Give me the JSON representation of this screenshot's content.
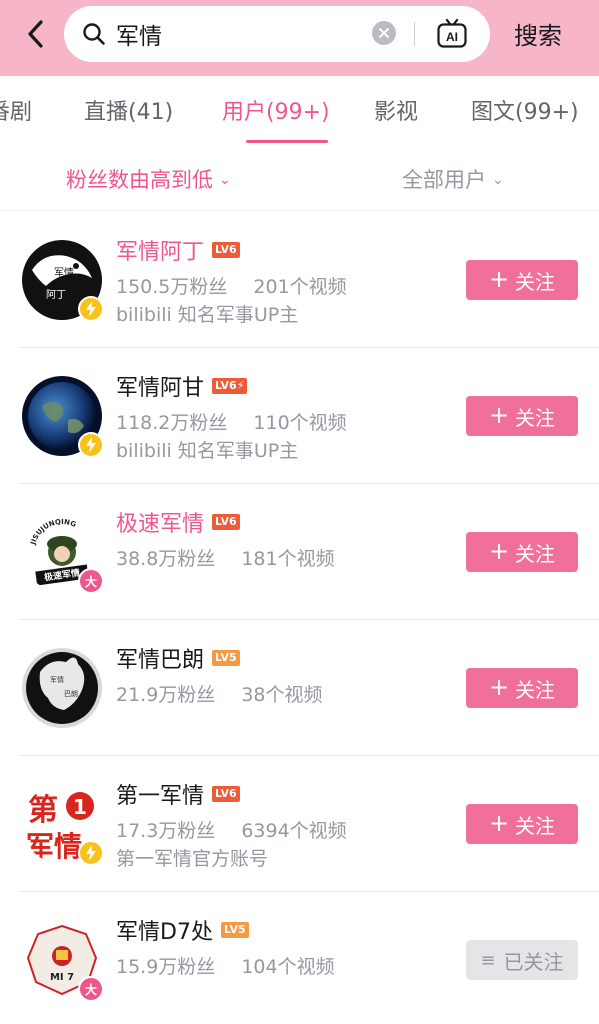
{
  "search": {
    "query": "军情",
    "submit_label": "搜索",
    "ai_label": "AI"
  },
  "tabs": [
    {
      "label": "番剧"
    },
    {
      "label": "直播(41)"
    },
    {
      "label": "用户(99+)"
    },
    {
      "label": "影视"
    },
    {
      "label": "图文(99+)"
    }
  ],
  "filters": {
    "sort": "粉丝数由高到低",
    "user_type": "全部用户"
  },
  "users": [
    {
      "name": "军情阿丁",
      "level": "LV6",
      "fans": "150.5万粉丝",
      "videos": "201个视频",
      "desc": "bilibili 知名军事UP主",
      "follow": "关注",
      "avatar_text_top": "军情",
      "avatar_text_bottom": "阿丁"
    },
    {
      "name": "军情阿甘",
      "level": "LV6",
      "fans": "118.2万粉丝",
      "videos": "110个视频",
      "desc": "bilibili 知名军事UP主",
      "follow": "关注"
    },
    {
      "name": "极速军情",
      "level": "LV6",
      "fans": "38.8万粉丝",
      "videos": "181个视频",
      "desc": "",
      "follow": "关注",
      "avatar_text_top": "JISUJUNQING",
      "avatar_text_bottom": "极速军情"
    },
    {
      "name": "军情巴朗",
      "level": "LV5",
      "fans": "21.9万粉丝",
      "videos": "38个视频",
      "desc": "",
      "follow": "关注",
      "avatar_text_top": "军情",
      "avatar_text_bottom": "巴朗"
    },
    {
      "name": "第一军情",
      "level": "LV6",
      "fans": "17.3万粉丝",
      "videos": "6394个视频",
      "desc": "第一军情官方账号",
      "follow": "关注",
      "avatar_text_top": "第",
      "avatar_text_mid": "1",
      "avatar_text_bottom": "军情"
    },
    {
      "name": "军情D7处",
      "level": "LV5",
      "fans": "15.9万粉丝",
      "videos": "104个视频",
      "desc": "",
      "follow": "已关注",
      "avatar_text_bottom": "MI 7"
    }
  ],
  "badges": {
    "big": "大"
  },
  "colors": {
    "header_bg": "#f6b6c8",
    "accent": "#f0568e",
    "follow_btn": "#f0709a",
    "level6": "#ef5a37",
    "level5": "#f59a40",
    "bolt_badge": "#f6c21b"
  }
}
